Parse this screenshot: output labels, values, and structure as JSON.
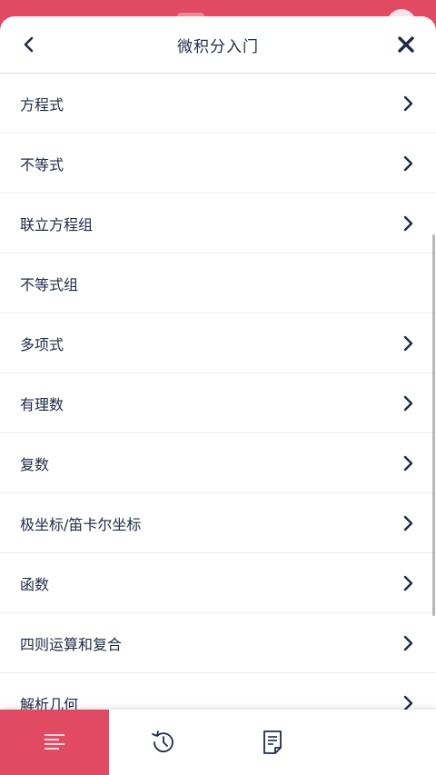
{
  "colors": {
    "accent": "#e04a62",
    "text": "#1f2a44",
    "divider": "#efefef"
  },
  "header": {
    "title": "微积分入门",
    "back_icon": "chevron-left-icon",
    "close_icon": "close-icon"
  },
  "list": {
    "items": [
      {
        "label": "方程式",
        "has_chevron": true
      },
      {
        "label": "不等式",
        "has_chevron": true
      },
      {
        "label": "联立方程组",
        "has_chevron": true
      },
      {
        "label": "不等式组",
        "has_chevron": false
      },
      {
        "label": "多项式",
        "has_chevron": true
      },
      {
        "label": "有理数",
        "has_chevron": true
      },
      {
        "label": "复数",
        "has_chevron": true
      },
      {
        "label": "极坐标/笛卡尔坐标",
        "has_chevron": true
      },
      {
        "label": "函数",
        "has_chevron": true
      },
      {
        "label": "四则运算和复合",
        "has_chevron": true
      },
      {
        "label": "解析几何",
        "has_chevron": true
      }
    ]
  },
  "bottom_nav": {
    "tabs": [
      {
        "icon": "list-icon",
        "active": true
      },
      {
        "icon": "history-icon",
        "active": false
      },
      {
        "icon": "notes-icon",
        "active": false
      }
    ]
  }
}
